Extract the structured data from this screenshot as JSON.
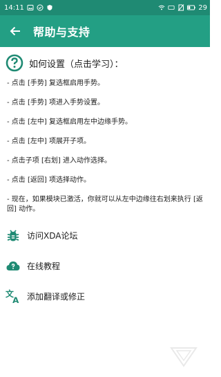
{
  "status": {
    "time": "14:11",
    "battery": "29"
  },
  "appbar": {
    "title": "帮助与支持"
  },
  "help": {
    "heading": "如何设置（点击学习）：",
    "steps": [
      "- 点击 [手势] 复选框启用手势。",
      "- 点击 [手势] 项进入手势设置。",
      "- 点击 [左中] 复选框启用左中边缘手势。",
      "- 点击 [左中] 项展开子项。",
      "- 点击子项 [右划] 进入动作选择。",
      "- 点击 [返回] 项选择动作。",
      "- 现在，如果模块已激活，你就可以从左中边缘往右划来执行 [返回] 动作。"
    ]
  },
  "links": {
    "xda": "访问XDA论坛",
    "tutorial": "在线教程",
    "translate": "添加翻译或修正"
  },
  "colors": {
    "statusbar": "#1f8a73",
    "appbar": "#239f84",
    "icon": "#1f8a73"
  }
}
